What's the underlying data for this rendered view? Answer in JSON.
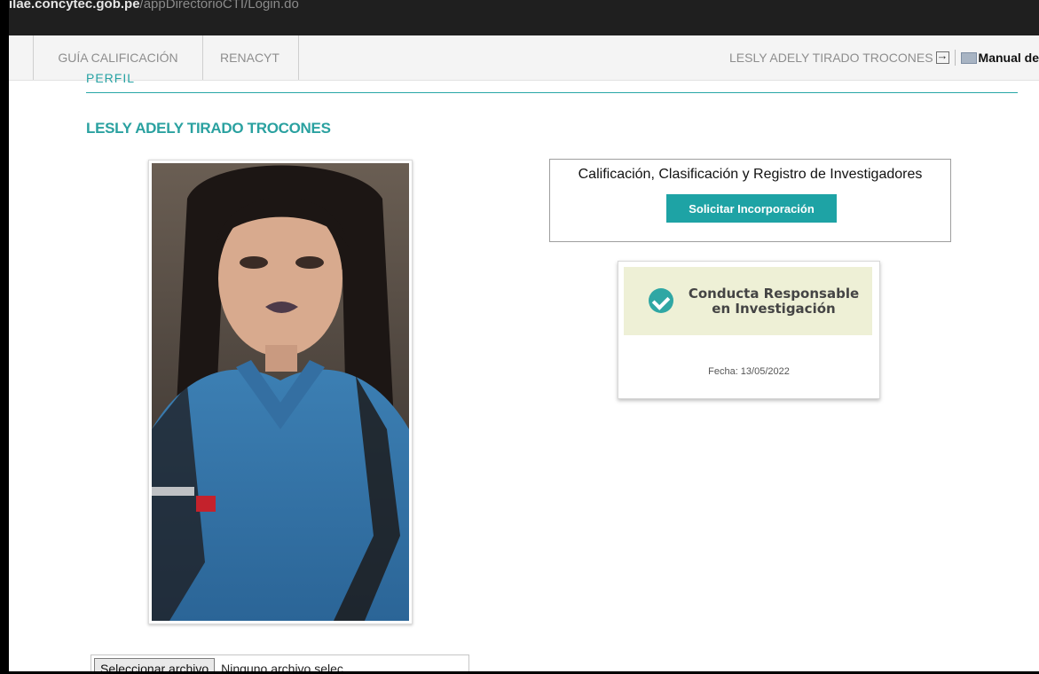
{
  "url": {
    "host": "ilae.concytec.gob.pe",
    "path": "/appDirectorioCTI/Login.do"
  },
  "nav": {
    "tabs": [
      {
        "label": "GUÍA CALIFICACIÓN"
      },
      {
        "label": "RENACYT"
      }
    ],
    "user_name": "LESLY ADELY TIRADO TROCONES",
    "manual_label": "Manual de"
  },
  "profile": {
    "section_heading": "PERFIL",
    "name": "LESLY ADELY TIRADO TROCONES"
  },
  "card": {
    "title": "Calificación, Clasificación y Registro de Investigadores",
    "button_label": "Solicitar Incorporación"
  },
  "certificate": {
    "line1": "Conducta Responsable",
    "line2": "en Investigación",
    "date": "Fecha: 13/05/2022"
  },
  "file_upload": {
    "button_label": "Seleccionar archivo",
    "status": "Ninguno archivo selec"
  },
  "colors": {
    "accent": "#1ea3a5",
    "heading": "#2aa1a0",
    "cert_bg": "#eef0d6"
  }
}
